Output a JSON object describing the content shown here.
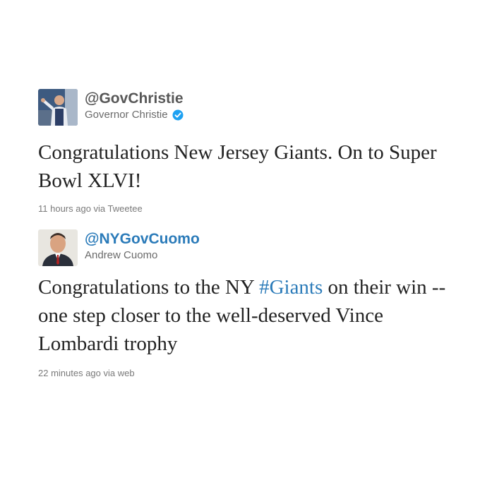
{
  "tweets": [
    {
      "handle": "@GovChristie",
      "display_name": "Governor Christie",
      "verified": true,
      "avatar_icon": "person-portrait-icon",
      "text_parts": [
        "Congratulations New Jersey Giants. On to Super Bowl XLVI!"
      ],
      "timestamp": "11 hours ago via Tweetee"
    },
    {
      "handle": "@NYGovCuomo",
      "display_name": "Andrew Cuomo",
      "verified": false,
      "avatar_icon": "person-portrait-icon",
      "text_before": "Congratulations to the NY ",
      "hashtag": "#Giants",
      "text_after": " on their win -- one step closer to the well-deserved Vince Lombardi trophy",
      "timestamp": "22 minutes ago via web"
    }
  ],
  "colors": {
    "link": "#2b7bb9",
    "verified_badge": "#1da1f2",
    "handle_gray": "#575757",
    "meta_gray": "#7a7a7a"
  }
}
